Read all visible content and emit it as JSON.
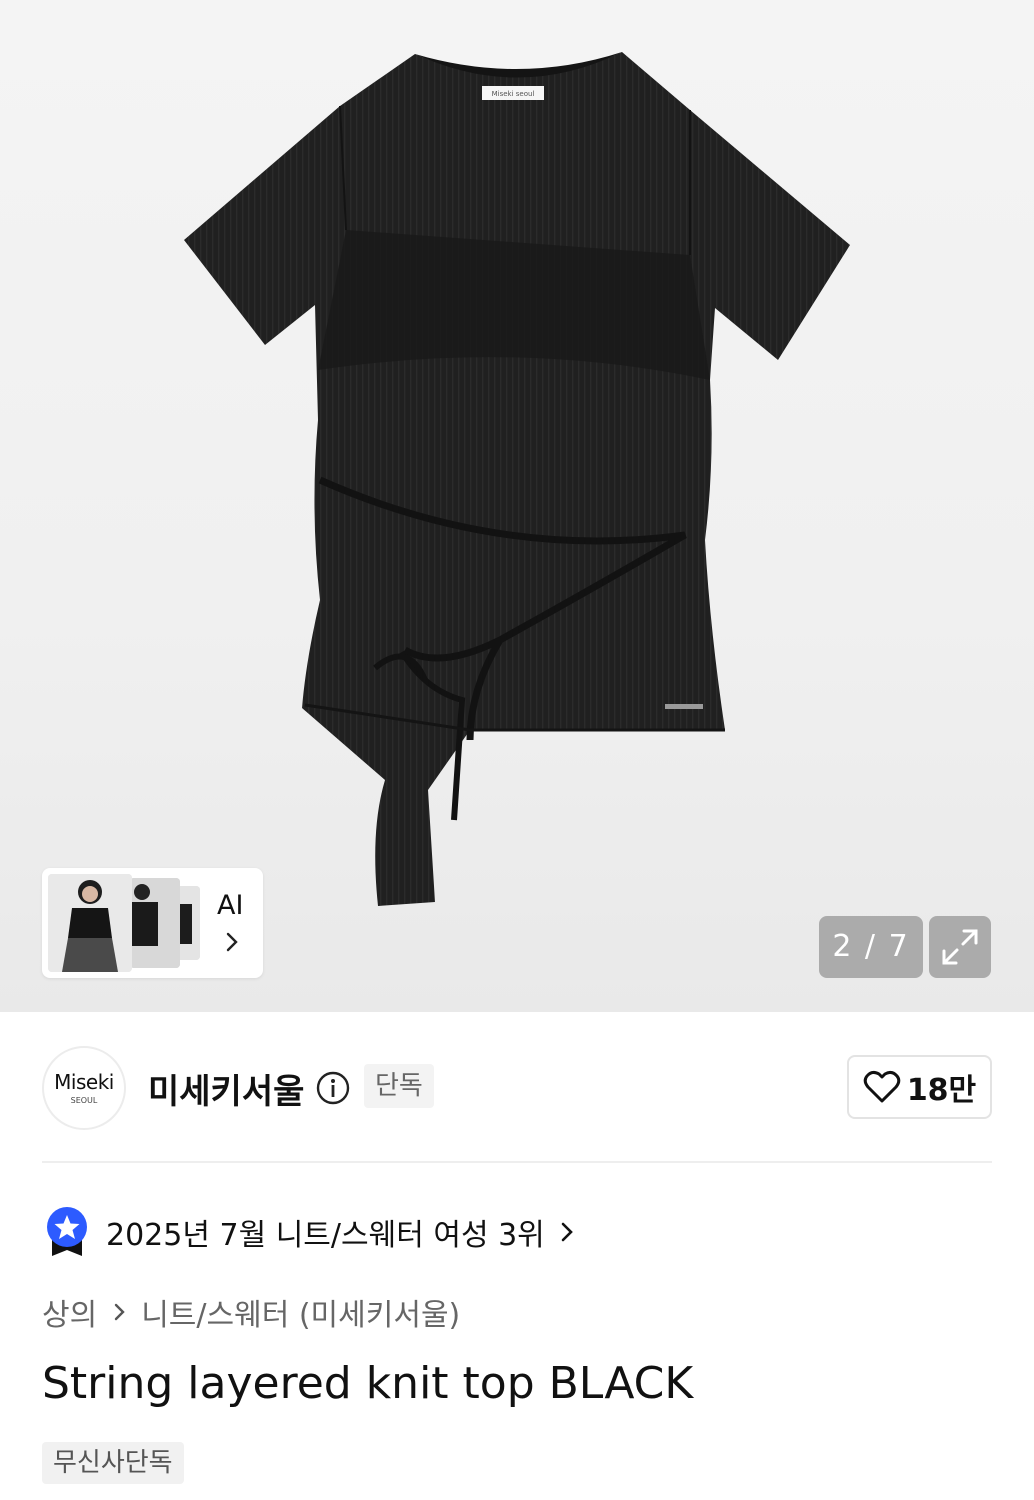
{
  "gallery": {
    "ai_card": {
      "label": "AI"
    },
    "counter": "2 / 7",
    "counter_accent": "#969696"
  },
  "brand": {
    "logo_main": "Miseki",
    "logo_sub": "SEOUL",
    "name": "미세키서울",
    "badge": "단독",
    "likes": "18만"
  },
  "ranking": {
    "text": "2025년 7월 니트/스웨터 여성 3위",
    "icon_color": "#2d5bff"
  },
  "breadcrumb": {
    "items": [
      "상의",
      "니트/스웨터 (미세키서울)"
    ]
  },
  "product": {
    "title": "String layered knit top BLACK",
    "tag": "무신사단독",
    "label_text": "Miseki seoul"
  },
  "icons": [
    "chevron-right-icon",
    "expand-icon",
    "info-icon",
    "heart-icon",
    "ranking-ribbon-icon"
  ]
}
